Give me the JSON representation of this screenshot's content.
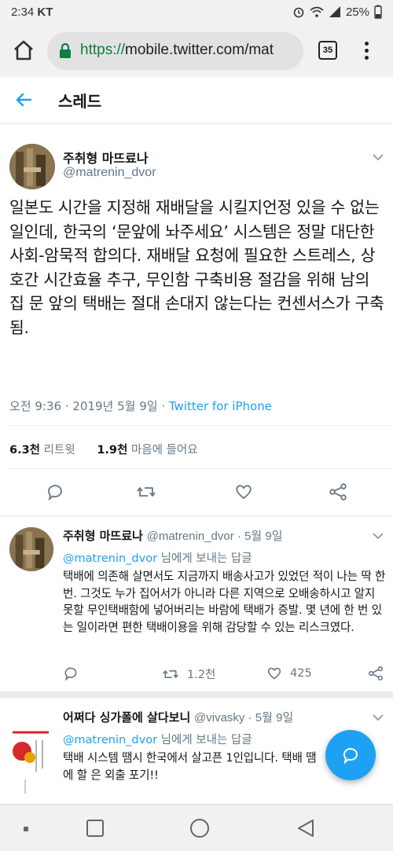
{
  "status_bar": {
    "time": "2:34",
    "carrier": "KT",
    "battery": "25%"
  },
  "browser": {
    "url_scheme": "https://",
    "url_rest": "mobile.twitter.com/mat",
    "tab_count": "35"
  },
  "app_bar": {
    "title": "스레드"
  },
  "main_tweet": {
    "name": "주취형 마뜨료나",
    "handle": "@matrenin_dvor",
    "body": "일본도 시간을 지정해 재배달을 시킬지언정 있을 수 없는 일인데, 한국의 ‘문앞에 놔주세요’ 시스템은 정말 대단한 사회-암묵적 합의다. 재배달 요청에 필요한 스트레스, 상호간 시간효율 추구, 무인함 구축비용 절감을 위해 남의 집 문 앞의 택배는 절대 손대지 않는다는 컨센서스가 구축됨.",
    "timestamp": "오전 9:36 · 2019년 5월 9일 · ",
    "source": "Twitter for iPhone",
    "retweets_count": "6.3천",
    "retweets_label": "리트윗",
    "likes_count": "1.9천",
    "likes_label": "마음에 들어요"
  },
  "replies": [
    {
      "name": "주취형 마뜨료나",
      "handle_date": "@matrenin_dvor · 5월 9일",
      "mention": "@matrenin_dvor",
      "to_suffix": " 님에게 보내는 답글",
      "text": "택배에 의존해 살면서도 지금까지 배송사고가 있었던 적이 나는 딱 한 번. 그것도 누가 집어서가 아니라 다른 지역으로 오배송하시고 알지 못할 무인택배함에 넣어버리는 바람에 택배가 증발. 몇 년에 한 번 있는 일이라면 편한 택배이용을 위해 감당할 수 있는 리스크였다.",
      "retweets": "1.2천",
      "likes": "425"
    },
    {
      "name": "어쩌다 싱가폴에 살다보니",
      "handle_date": "@vivasky · 5월 9일",
      "mention": "@matrenin_dvor",
      "to_suffix": " 님에게 보내는 답글",
      "text": "택배 시스템 땜시 한국에서 살고픈 1인입니다. 택배 땜에 할 은 외출 포기!!"
    }
  ],
  "colors": {
    "accent": "#1da1f2",
    "secondary_text": "#657786",
    "primary_text": "#14171a",
    "divider": "#e6ecf0"
  },
  "icons": [
    "home-icon",
    "lock-icon",
    "menu-icon",
    "back-arrow-icon",
    "chevron-down-icon",
    "reply-icon",
    "retweet-icon",
    "heart-icon",
    "share-icon",
    "compose-icon"
  ]
}
